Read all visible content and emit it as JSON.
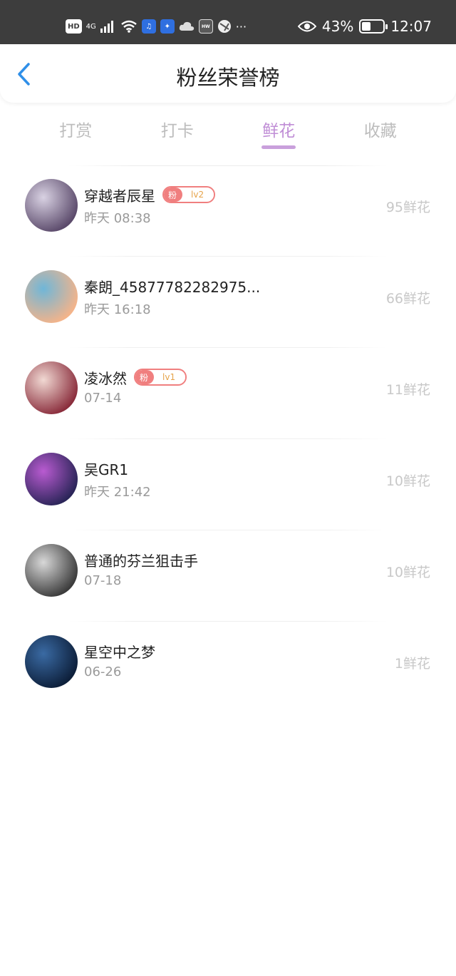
{
  "status_bar": {
    "left_items": [
      "HD",
      "4G"
    ],
    "battery_percent": "43%",
    "battery_level": 0.43,
    "time": "12:07"
  },
  "header": {
    "title": "粉丝荣誉榜"
  },
  "tabs": [
    {
      "label": "打赏",
      "active": false
    },
    {
      "label": "打卡",
      "active": false
    },
    {
      "label": "鲜花",
      "active": true
    },
    {
      "label": "收藏",
      "active": false
    }
  ],
  "fans": [
    {
      "name": "穿越者辰星",
      "time": "昨天 08:38",
      "score": "95鲜花",
      "badge": {
        "fan": "粉",
        "level": "lv2"
      },
      "avatar_colors": [
        "#5b4a6b",
        "#d9d2e3"
      ]
    },
    {
      "name": "秦朗_45877782282975...",
      "time": "昨天 16:18",
      "score": "66鲜花",
      "badge": null,
      "avatar_colors": [
        "#f4b48a",
        "#6fb6d8"
      ]
    },
    {
      "name": "凌冰然",
      "time": "07-14",
      "score": "11鲜花",
      "badge": {
        "fan": "粉",
        "level": "lv1"
      },
      "avatar_colors": [
        "#8a2d3c",
        "#f1d9d3"
      ]
    },
    {
      "name": "吴GR1",
      "time": "昨天 21:42",
      "score": "10鲜花",
      "badge": null,
      "avatar_colors": [
        "#2a2558",
        "#b95bd1"
      ]
    },
    {
      "name": "普通的芬兰狙击手",
      "time": "07-18",
      "score": "10鲜花",
      "badge": null,
      "avatar_colors": [
        "#3b3b3b",
        "#d8d8d8"
      ]
    },
    {
      "name": "星空中之梦",
      "time": "06-26",
      "score": "1鲜花",
      "badge": null,
      "avatar_colors": [
        "#0d1f3a",
        "#3a6aa3"
      ]
    }
  ]
}
